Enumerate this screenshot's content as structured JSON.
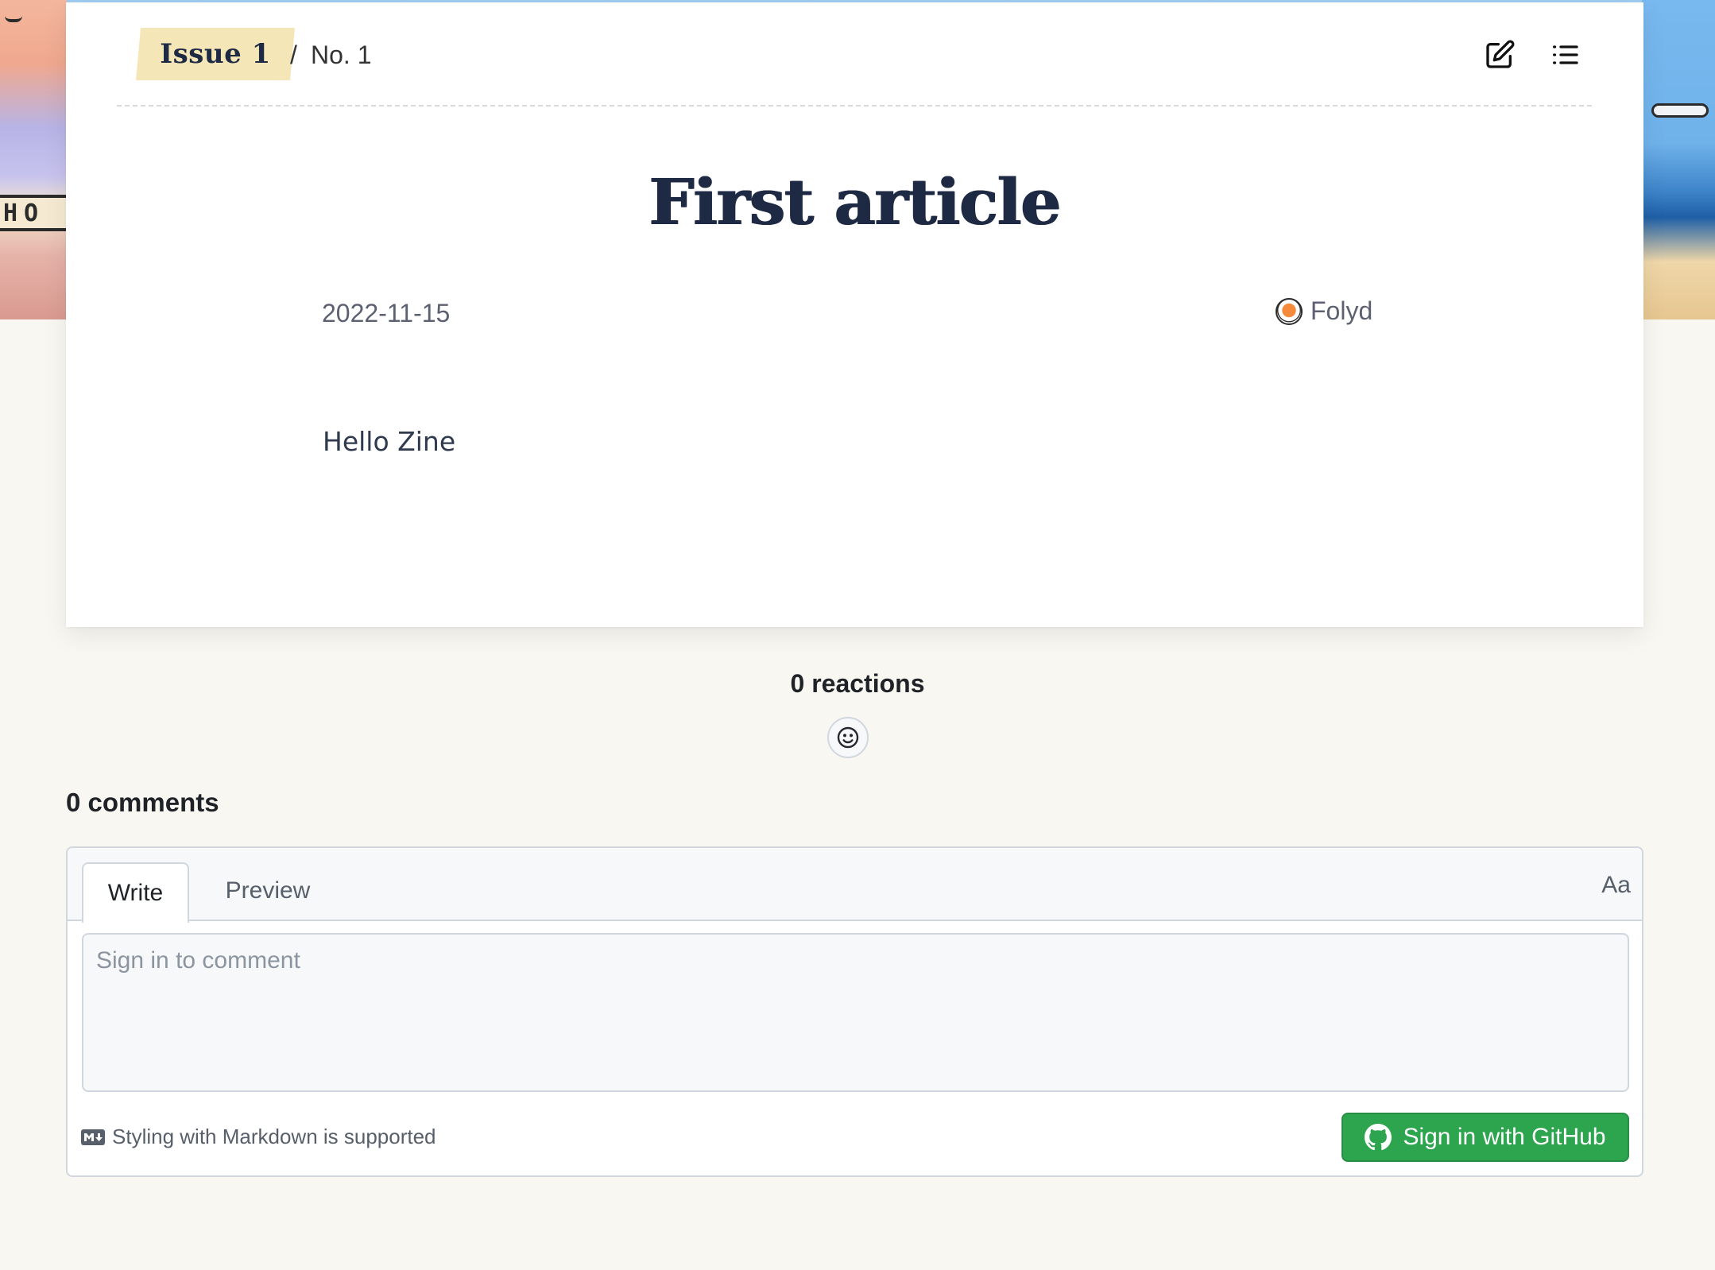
{
  "article_nav": {
    "issue_label": "Issue 1",
    "separator": "/",
    "issue_number": "No. 1",
    "edit_icon": "edit-icon",
    "toc_icon": "list-icon"
  },
  "article": {
    "title": "First article",
    "date": "2022-11-15",
    "author": "Folyd",
    "body": "Hello Zine"
  },
  "reactions": {
    "count_label": "0 reactions",
    "add_icon": "smiley-icon"
  },
  "comments": {
    "count_label": "0 comments",
    "tabs": [
      {
        "label": "Write",
        "active": true
      },
      {
        "label": "Preview",
        "active": false
      }
    ],
    "format_label": "Aa",
    "input_placeholder": "Sign in to comment",
    "markdown_hint": "Styling with Markdown is supported",
    "signin_label": "Sign in with GitHub"
  },
  "colors": {
    "page_bg": "#f8f7f2",
    "title": "#1e2a44",
    "issue_tag_bg": "#f5e6b8",
    "signin_green": "#2da44e"
  }
}
